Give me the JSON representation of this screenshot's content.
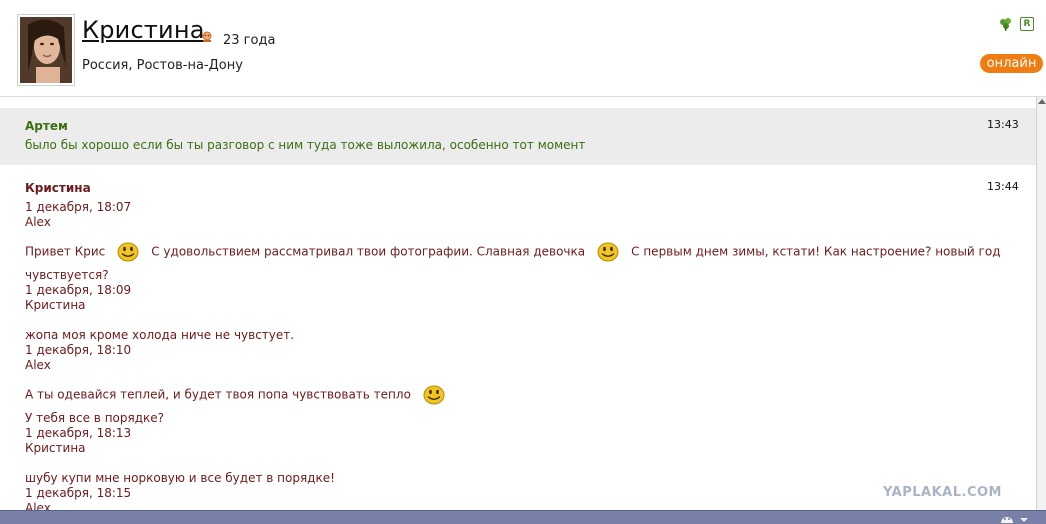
{
  "profile": {
    "name": "Кристина",
    "age": "23 года",
    "location": "Россия, Ростов-на-Дону",
    "status": "онлайн",
    "badge": "R"
  },
  "messages": [
    {
      "author": "Артем",
      "time": "13:43",
      "lines": [
        "было бы хорошо если бы ты разговор с ним туда тоже выложила, особенно тот момент"
      ]
    },
    {
      "author": "Кристина",
      "time": "13:44",
      "entries": {
        "e1_date": "1 декабря, 18:07",
        "e1_name": "Alex",
        "e1_text_a": "Привет Крис",
        "e1_text_b": "С удовольствием рассматривал твои фотографии. Славная девочка",
        "e1_text_c": "С первым днем зимы, кстати! Как настроение? новый год",
        "e1_text_d": "чувствуется?",
        "e2_date": "1 декабря, 18:09",
        "e2_name": "Кристина",
        "e2_text": "жопа моя кроме холода ниче не чувстует.",
        "e3_date": "1 декабря, 18:10",
        "e3_name": "Alex",
        "e3_text_a": "А ты одевайся теплей, и будет твоя попа чувствовать тепло",
        "e3_text_b": "У тебя все в порядке?",
        "e4_date": "1 декабря, 18:13",
        "e4_name": "Кристина",
        "e4_text": "шубу купи мне норковую и все будет в порядке!",
        "e5_date": "1 декабря, 18:15",
        "e5_name": "Alex"
      }
    }
  ],
  "watermark": "YAPLAKAL.COM",
  "colors": {
    "accent_online": "#f07c12",
    "author_green": "#3c6e13",
    "author_maroon": "#6e1a1a",
    "highlight_bg": "#ececec",
    "bottom_bar": "#7880a8"
  },
  "icons": [
    "gender-female-icon",
    "clover-icon",
    "smiley-icon",
    "scroll-up-icon",
    "chevron-down-icon"
  ]
}
